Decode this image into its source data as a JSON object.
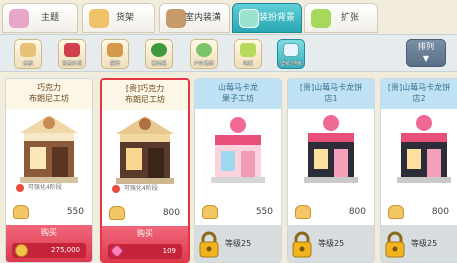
{
  "tabs": [
    {
      "label": "主题",
      "icon": "bag-icon"
    },
    {
      "label": "货架",
      "icon": "shelf-icon"
    },
    {
      "label": "室内装潢",
      "icon": "interior-icon"
    },
    {
      "label": "装扮背景",
      "icon": "background-icon",
      "active": true
    },
    {
      "label": "扩张",
      "icon": "expand-icon"
    }
  ],
  "subcategories": [
    {
      "label": "全部",
      "icon": "bread-icon"
    },
    {
      "label": "商店外观",
      "icon": "storefront-icon"
    },
    {
      "label": "招牌",
      "icon": "signboard-icon"
    },
    {
      "label": "装饰品",
      "icon": "tree-icon"
    },
    {
      "label": "户外装饰",
      "icon": "garden-icon"
    },
    {
      "label": "地板",
      "icon": "floor-icon"
    },
    {
      "label": "壁纸/地板",
      "icon": "wallpaper-icon",
      "selected": true
    }
  ],
  "sort": {
    "label": "排列"
  },
  "items": [
    {
      "name": "巧克力\n布朗尼工坊",
      "enhance": "可强化4阶段",
      "price": "550",
      "buy_label": "购买",
      "cost": "275,000",
      "cost_icon": "coin-icon",
      "locked": false
    },
    {
      "name": "[贵]巧克力\n布朗尼工坊",
      "enhance": "可强化4阶段",
      "price": "800",
      "buy_label": "购买",
      "cost": "109",
      "cost_icon": "gem-icon",
      "locked": false,
      "selected": true
    },
    {
      "name": "山莓马卡龙\n果子工坊",
      "price": "550",
      "level": "等级25",
      "locked": true
    },
    {
      "name": "[贵]山莓马卡龙饼\n店1",
      "price": "800",
      "level": "等级25",
      "locked": true
    },
    {
      "name": "[贵]山莓马卡龙饼\n店2",
      "price": "800",
      "level": "等级25",
      "locked": true
    }
  ],
  "colors": {
    "accent_tab": "#2aa6b3",
    "buy_button": "#d9364c",
    "selected_border": "#e23642"
  }
}
